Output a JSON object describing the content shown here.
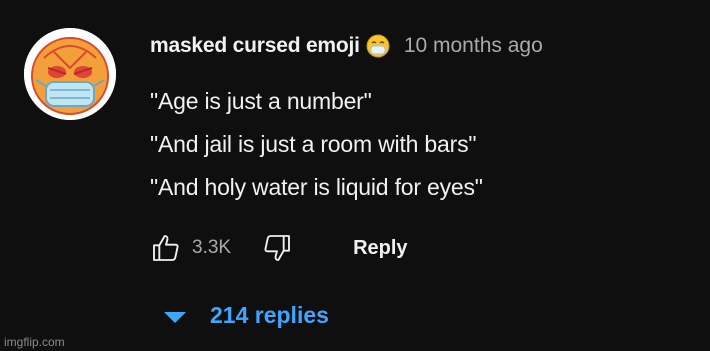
{
  "comment": {
    "author": "masked cursed emoji",
    "timestamp": "10 months ago",
    "lines": [
      "\"Age is just a number\"",
      "\"And jail is just a room with bars\"",
      "\"And holy water is liquid for eyes\""
    ],
    "like_count": "3.3K",
    "reply_label": "Reply",
    "replies_label": "214 replies"
  },
  "icons": {
    "like": "thumbs-up-icon",
    "dislike": "thumbs-down-icon",
    "expand": "caret-down-icon",
    "badge": "masked-emoji-icon"
  },
  "colors": {
    "background": "#0f0f0f",
    "text": "#f1f1f1",
    "secondary": "#aaaaaa",
    "link": "#3ea6ff"
  },
  "watermark": "imgflip.com"
}
